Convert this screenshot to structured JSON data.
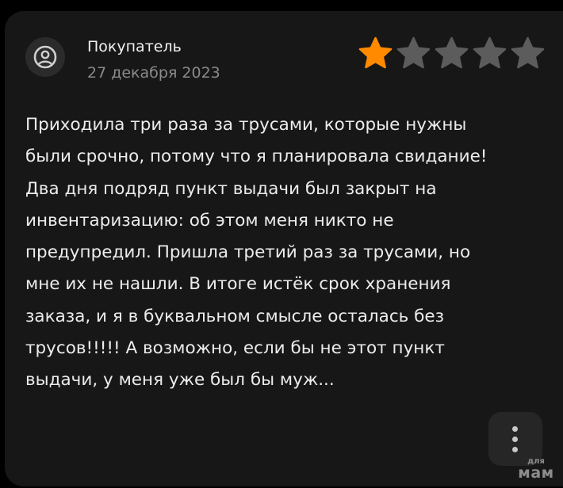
{
  "review": {
    "author": "Покупатель",
    "date": "27 декабря 2023",
    "rating": {
      "value": 1,
      "max": 5
    },
    "text_lines": [
      "Приходила три раза за трусами, которые нужны",
      "были срочно, потому что я планировала свидание!",
      "Два дня подряд пункт выдачи был закрыт на",
      "инвентаризацию: об этом меня никто не",
      "предупредил. Пришла третий раз за трусами, но",
      "мне их не нашли. В итоге истёк срок хранения",
      "заказа, и я в буквальном смысле осталась без",
      "трусов!!!!! А возможно, если бы не этот пункт",
      "выдачи, у меня уже был бы муж..."
    ]
  },
  "icons": {
    "avatar": "user-circle-icon",
    "star_filled": "star-filled-icon",
    "star_empty": "star-empty-icon",
    "more": "more-vertical-icon"
  },
  "colors": {
    "background": "#000000",
    "card": "#171717",
    "star_filled": "#ff8a00",
    "star_empty": "#5c5c5c",
    "muted_text": "#8a8a8a"
  },
  "watermark": {
    "small": "для",
    "big": "мам"
  }
}
